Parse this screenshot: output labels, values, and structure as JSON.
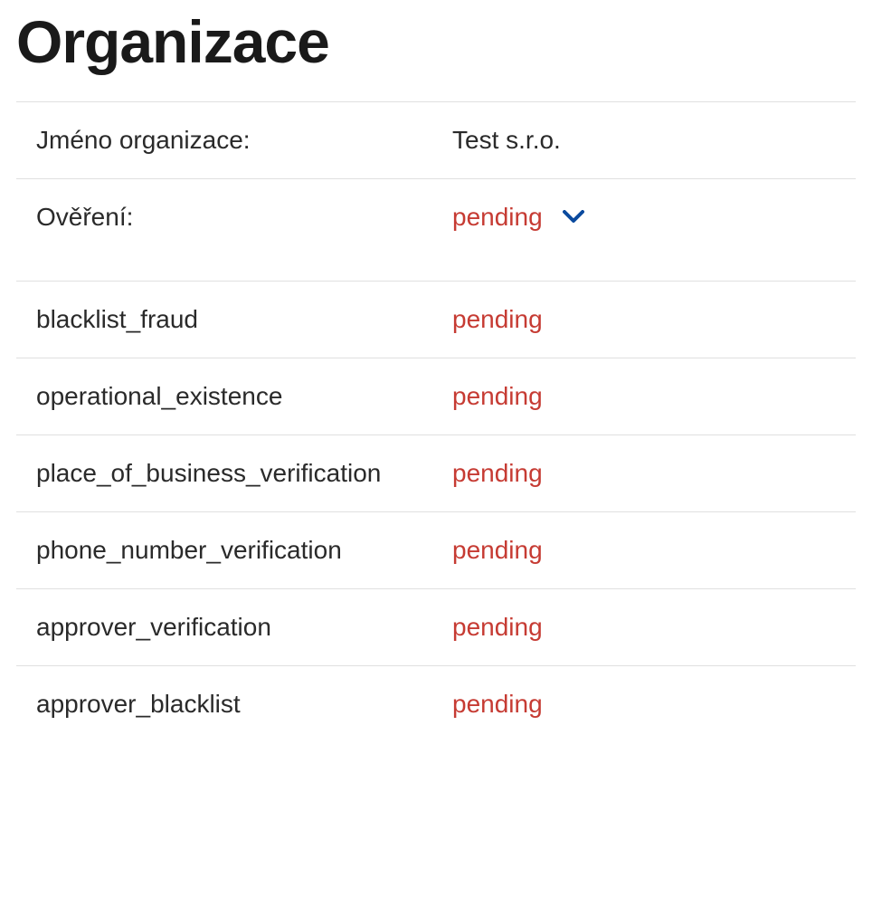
{
  "title": "Organizace",
  "nameRow": {
    "label": "Jméno organizace:",
    "value": "Test s.r.o."
  },
  "verificationRow": {
    "label": "Ověření:",
    "value": "pending"
  },
  "checks": [
    {
      "label": "blacklist_fraud",
      "status": "pending"
    },
    {
      "label": "operational_existence",
      "status": "pending"
    },
    {
      "label": "place_of_business_verification",
      "status": "pending"
    },
    {
      "label": "phone_number_verification",
      "status": "pending"
    },
    {
      "label": "approver_verification",
      "status": "pending"
    },
    {
      "label": "approver_blacklist",
      "status": "pending"
    }
  ]
}
